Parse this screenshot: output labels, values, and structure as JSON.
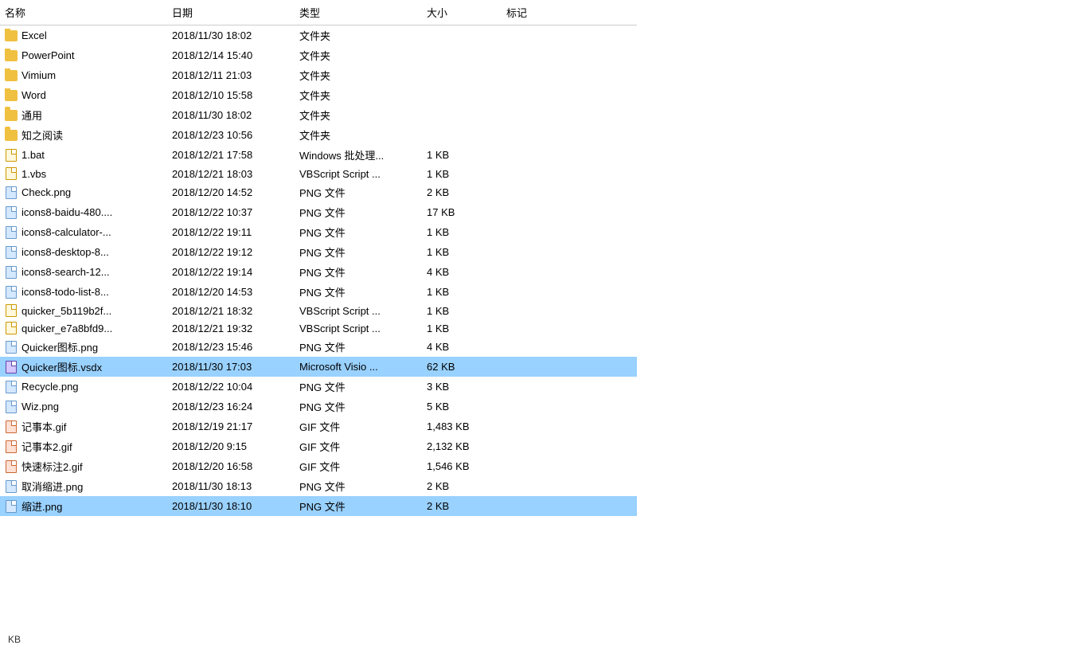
{
  "columns": {
    "name": "名称",
    "date": "日期",
    "type": "类型",
    "size": "大小",
    "tags": "标记"
  },
  "files": [
    {
      "name": "Excel",
      "date": "2018/11/30 18:02",
      "type": "文件夹",
      "size": "",
      "tags": "",
      "iconType": "folder",
      "selected": false
    },
    {
      "name": "PowerPoint",
      "date": "2018/12/14 15:40",
      "type": "文件夹",
      "size": "",
      "tags": "",
      "iconType": "folder",
      "selected": false
    },
    {
      "name": "Vimium",
      "date": "2018/12/11 21:03",
      "type": "文件夹",
      "size": "",
      "tags": "",
      "iconType": "folder",
      "selected": false
    },
    {
      "name": "Word",
      "date": "2018/12/10 15:58",
      "type": "文件夹",
      "size": "",
      "tags": "",
      "iconType": "folder",
      "selected": false
    },
    {
      "name": "通用",
      "date": "2018/11/30 18:02",
      "type": "文件夹",
      "size": "",
      "tags": "",
      "iconType": "folder",
      "selected": false
    },
    {
      "name": "知之阅读",
      "date": "2018/12/23 10:56",
      "type": "文件夹",
      "size": "",
      "tags": "",
      "iconType": "folder",
      "selected": false
    },
    {
      "name": "1.bat",
      "date": "2018/12/21 17:58",
      "type": "Windows 批处理...",
      "size": "1 KB",
      "tags": "",
      "iconType": "script",
      "selected": false
    },
    {
      "name": "1.vbs",
      "date": "2018/12/21 18:03",
      "type": "VBScript Script ...",
      "size": "1 KB",
      "tags": "",
      "iconType": "script",
      "selected": false
    },
    {
      "name": "Check.png",
      "date": "2018/12/20 14:52",
      "type": "PNG 文件",
      "size": "2 KB",
      "tags": "",
      "iconType": "png",
      "selected": false
    },
    {
      "name": "icons8-baidu-480....",
      "date": "2018/12/22 10:37",
      "type": "PNG 文件",
      "size": "17 KB",
      "tags": "",
      "iconType": "png",
      "selected": false
    },
    {
      "name": "icons8-calculator-...",
      "date": "2018/12/22 19:11",
      "type": "PNG 文件",
      "size": "1 KB",
      "tags": "",
      "iconType": "png",
      "selected": false
    },
    {
      "name": "icons8-desktop-8...",
      "date": "2018/12/22 19:12",
      "type": "PNG 文件",
      "size": "1 KB",
      "tags": "",
      "iconType": "png",
      "selected": false
    },
    {
      "name": "icons8-search-12...",
      "date": "2018/12/22 19:14",
      "type": "PNG 文件",
      "size": "4 KB",
      "tags": "",
      "iconType": "png",
      "selected": false
    },
    {
      "name": "icons8-todo-list-8...",
      "date": "2018/12/20 14:53",
      "type": "PNG 文件",
      "size": "1 KB",
      "tags": "",
      "iconType": "png",
      "selected": false
    },
    {
      "name": "quicker_5b119b2f...",
      "date": "2018/12/21 18:32",
      "type": "VBScript Script ...",
      "size": "1 KB",
      "tags": "",
      "iconType": "script",
      "selected": false
    },
    {
      "name": "quicker_e7a8bfd9...",
      "date": "2018/12/21 19:32",
      "type": "VBScript Script ...",
      "size": "1 KB",
      "tags": "",
      "iconType": "script",
      "selected": false
    },
    {
      "name": "Quicker图标.png",
      "date": "2018/12/23 15:46",
      "type": "PNG 文件",
      "size": "4 KB",
      "tags": "",
      "iconType": "png",
      "selected": false
    },
    {
      "name": "Quicker图标.vsdx",
      "date": "2018/11/30 17:03",
      "type": "Microsoft Visio ...",
      "size": "62 KB",
      "tags": "",
      "iconType": "visio",
      "selected": true
    },
    {
      "name": "Recycle.png",
      "date": "2018/12/22 10:04",
      "type": "PNG 文件",
      "size": "3 KB",
      "tags": "",
      "iconType": "png",
      "selected": false
    },
    {
      "name": "Wiz.png",
      "date": "2018/12/23 16:24",
      "type": "PNG 文件",
      "size": "5 KB",
      "tags": "",
      "iconType": "png",
      "selected": false
    },
    {
      "name": "记事本.gif",
      "date": "2018/12/19 21:17",
      "type": "GIF 文件",
      "size": "1,483 KB",
      "tags": "",
      "iconType": "gif",
      "selected": false
    },
    {
      "name": "记事本2.gif",
      "date": "2018/12/20 9:15",
      "type": "GIF 文件",
      "size": "2,132 KB",
      "tags": "",
      "iconType": "gif",
      "selected": false
    },
    {
      "name": "快速标注2.gif",
      "date": "2018/12/20 16:58",
      "type": "GIF 文件",
      "size": "1,546 KB",
      "tags": "",
      "iconType": "gif",
      "selected": false
    },
    {
      "name": "取消缩进.png",
      "date": "2018/11/30 18:13",
      "type": "PNG 文件",
      "size": "2 KB",
      "tags": "",
      "iconType": "png",
      "selected": false
    },
    {
      "name": "缩进.png",
      "date": "2018/11/30 18:10",
      "type": "PNG 文件",
      "size": "2 KB",
      "tags": "",
      "iconType": "png",
      "selected": true
    }
  ],
  "statusBar": {
    "text": "KB"
  }
}
